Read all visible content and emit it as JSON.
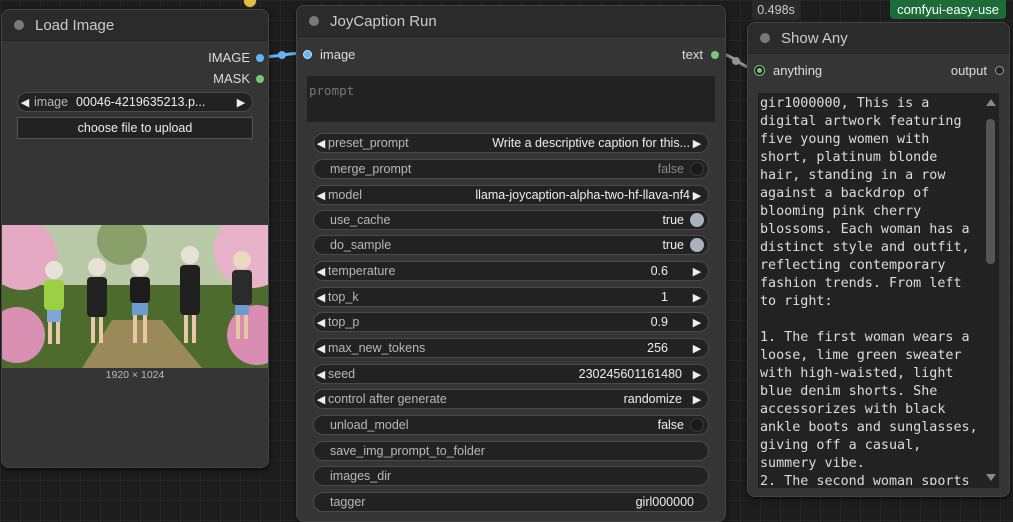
{
  "badges": {
    "elapsed": "0.498s",
    "easy_use": "comfyui-easy-use"
  },
  "load_image": {
    "title": "Load Image",
    "outputs": [
      "IMAGE",
      "MASK"
    ],
    "image_label": "image",
    "image_value": "00046-4219635213.p...",
    "upload_label": "choose file to upload",
    "dimensions": "1920 × 1024"
  },
  "joycaption": {
    "title": "JoyCaption Run",
    "input_label": "image",
    "output_label": "text",
    "prompt_placeholder": "prompt",
    "widgets": {
      "preset_prompt": {
        "name": "preset_prompt",
        "value": "Write a descriptive caption for this..."
      },
      "merge_prompt": {
        "name": "merge_prompt",
        "value": "false"
      },
      "model": {
        "name": "model",
        "value": "llama-joycaption-alpha-two-hf-llava-nf4"
      },
      "use_cache": {
        "name": "use_cache",
        "value": "true"
      },
      "do_sample": {
        "name": "do_sample",
        "value": "true"
      },
      "temperature": {
        "name": "temperature",
        "value": "0.6"
      },
      "top_k": {
        "name": "top_k",
        "value": "1"
      },
      "top_p": {
        "name": "top_p",
        "value": "0.9"
      },
      "max_new_tokens": {
        "name": "max_new_tokens",
        "value": "256"
      },
      "seed": {
        "name": "seed",
        "value": "230245601161480"
      },
      "control_after_generate": {
        "name": "control after generate",
        "value": "randomize"
      },
      "unload_model": {
        "name": "unload_model",
        "value": "false"
      },
      "save_img_prompt_to_folder": {
        "name": "save_img_prompt_to_folder"
      },
      "images_dir": {
        "name": "images_dir"
      },
      "tagger": {
        "name": "tagger",
        "value": "girl000000"
      }
    }
  },
  "show_any": {
    "title": "Show Any",
    "input_label": "anything",
    "output_label": "output",
    "text": "gir1000000, This is a digital artwork featuring five young women with short, platinum blonde hair, standing in a row against a backdrop of blooming pink cherry blossoms. Each woman has a distinct style and outfit, reflecting contemporary fashion trends. From left to right:\n\n1. The first woman wears a loose, lime green sweater with high-waisted, light blue denim shorts. She accessorizes with black ankle boots and sunglasses, giving off a casual, summery vibe.\n2. The second woman sports"
  },
  "colors": {
    "image_link": "#64b5f6",
    "string_link": "#7ac77a",
    "easy_badge": "#1e6b3a"
  }
}
